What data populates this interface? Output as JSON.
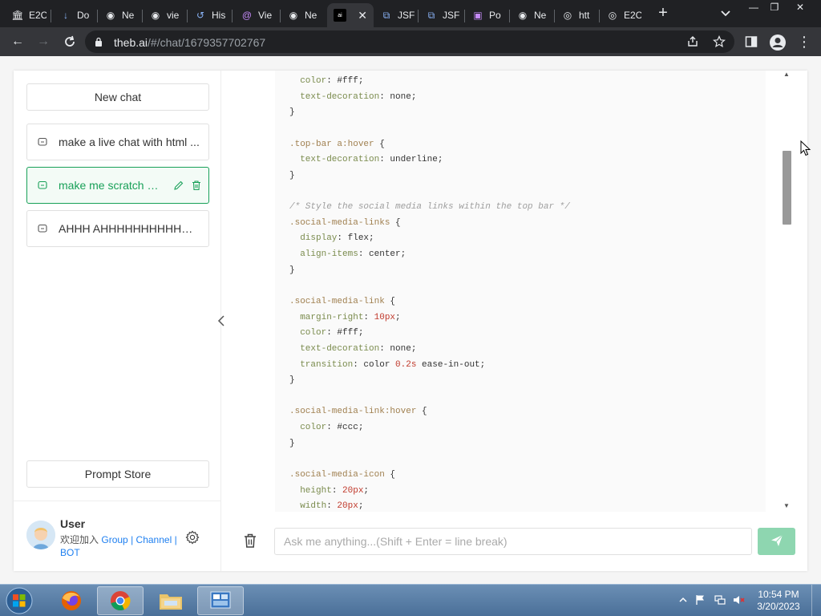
{
  "browser": {
    "tabs": [
      {
        "label": "E2C",
        "icon": "bank-icon"
      },
      {
        "label": "Do",
        "icon": "download-icon"
      },
      {
        "label": "Ne",
        "icon": "chrome-icon"
      },
      {
        "label": "vie",
        "icon": "chrome-icon"
      },
      {
        "label": "His",
        "icon": "history-icon"
      },
      {
        "label": "Vie",
        "icon": "at-icon"
      },
      {
        "label": "Ne",
        "icon": "chrome-icon"
      },
      {
        "label": "",
        "icon": "theb-icon",
        "active": true
      },
      {
        "label": "JSF",
        "icon": "codepen-icon"
      },
      {
        "label": "JSF",
        "icon": "codepen-icon"
      },
      {
        "label": "Po",
        "icon": "poe-icon"
      },
      {
        "label": "Ne",
        "icon": "chrome-icon"
      },
      {
        "label": "htt",
        "icon": "globe-icon"
      },
      {
        "label": "E2C",
        "icon": "globe-icon"
      }
    ],
    "url_host": "theb.ai",
    "url_path": "/#/chat/1679357702767"
  },
  "sidebar": {
    "new_chat_label": "New chat",
    "chats": [
      {
        "title": "make a live chat with html ..."
      },
      {
        "title": "make me scratch c...",
        "active": true
      },
      {
        "title": "AHHH AHHHHHHHHHHHH..."
      }
    ],
    "prompt_store_label": "Prompt Store",
    "user": {
      "name": "User",
      "join_text": "欢迎加入",
      "links": [
        "Group",
        "Channel"
      ],
      "sep": "|",
      "bot_label": "BOT"
    }
  },
  "code": {
    "lines": [
      [
        [
          "prop",
          "  color"
        ],
        [
          "val",
          ": #fff;"
        ]
      ],
      [
        [
          "prop",
          "  text-decoration"
        ],
        [
          "val",
          ": none;"
        ]
      ],
      [
        [
          "val",
          "}"
        ]
      ],
      [],
      [
        [
          "sel",
          ".top-bar a:hover"
        ],
        [
          "val",
          " {"
        ]
      ],
      [
        [
          "prop",
          "  text-decoration"
        ],
        [
          "val",
          ": underline;"
        ]
      ],
      [
        [
          "val",
          "}"
        ]
      ],
      [],
      [
        [
          "com",
          "/* Style the social media links within the top bar */"
        ]
      ],
      [
        [
          "sel",
          ".social-media-links"
        ],
        [
          "val",
          " {"
        ]
      ],
      [
        [
          "prop",
          "  display"
        ],
        [
          "val",
          ": flex;"
        ]
      ],
      [
        [
          "prop",
          "  align-items"
        ],
        [
          "val",
          ": center;"
        ]
      ],
      [
        [
          "val",
          "}"
        ]
      ],
      [],
      [
        [
          "sel",
          ".social-media-link"
        ],
        [
          "val",
          " {"
        ]
      ],
      [
        [
          "prop",
          "  margin-right"
        ],
        [
          "val",
          ": "
        ],
        [
          "num",
          "10px"
        ],
        [
          "val",
          ";"
        ]
      ],
      [
        [
          "prop",
          "  color"
        ],
        [
          "val",
          ": #fff;"
        ]
      ],
      [
        [
          "prop",
          "  text-decoration"
        ],
        [
          "val",
          ": none;"
        ]
      ],
      [
        [
          "prop",
          "  transition"
        ],
        [
          "val",
          ": color "
        ],
        [
          "num",
          "0.2s"
        ],
        [
          "val",
          " ease-in-out;"
        ]
      ],
      [
        [
          "val",
          "}"
        ]
      ],
      [],
      [
        [
          "sel",
          ".social-media-link:hover"
        ],
        [
          "val",
          " {"
        ]
      ],
      [
        [
          "prop",
          "  color"
        ],
        [
          "val",
          ": #ccc;"
        ]
      ],
      [
        [
          "val",
          "}"
        ]
      ],
      [],
      [
        [
          "sel",
          ".social-media-icon"
        ],
        [
          "val",
          " {"
        ]
      ],
      [
        [
          "prop",
          "  height"
        ],
        [
          "val",
          ": "
        ],
        [
          "num",
          "20px"
        ],
        [
          "val",
          ";"
        ]
      ],
      [
        [
          "prop",
          "  width"
        ],
        [
          "val",
          ": "
        ],
        [
          "num",
          "20px"
        ],
        [
          "val",
          ";"
        ]
      ]
    ]
  },
  "input": {
    "placeholder": "Ask me anything...(Shift + Enter = line break)"
  },
  "taskbar": {
    "time": "10:54 PM",
    "date": "3/20/2023"
  },
  "colors": {
    "accent": "#18a058",
    "send_disabled": "#8ed6b0",
    "link": "#2080f0"
  }
}
